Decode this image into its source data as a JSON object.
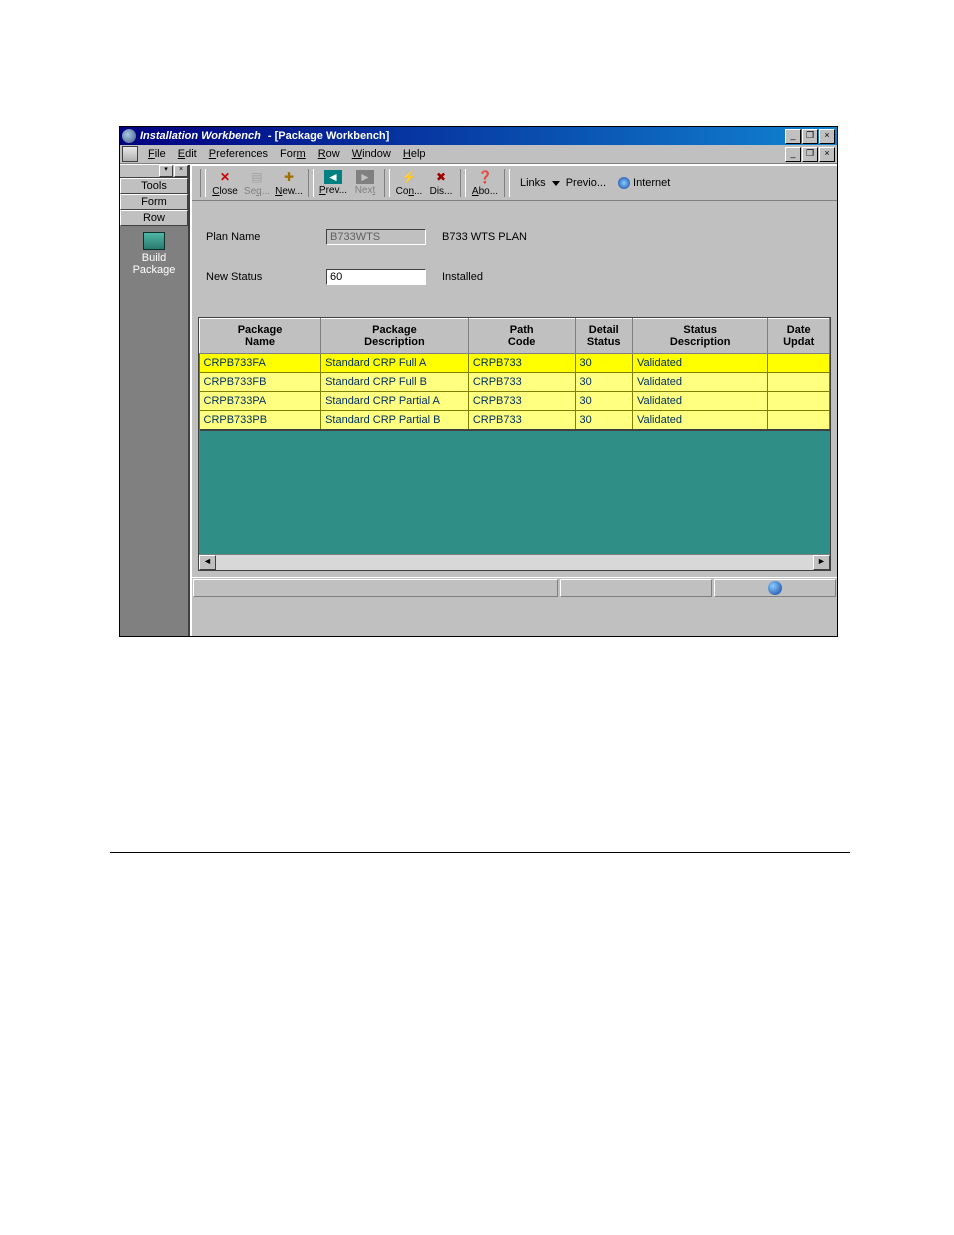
{
  "window": {
    "app_title": "Installation Workbench",
    "doc_title": "[Package Workbench]"
  },
  "menu": {
    "file": "File",
    "edit": "Edit",
    "preferences": "Preferences",
    "form": "Form",
    "row": "Row",
    "window": "Window",
    "help": "Help"
  },
  "sidebar": {
    "tabs": [
      "Tools",
      "Form",
      "Row"
    ],
    "action": {
      "line1": "Build",
      "line2": "Package"
    }
  },
  "toolbar": {
    "close": "Close",
    "seq": "Seq...",
    "new": "New...",
    "prev": "Prev...",
    "next": "Next",
    "con": "Con...",
    "dis": "Dis...",
    "abo": "Abo...",
    "links_label": "Links",
    "previo": "Previo...",
    "internet": "Internet"
  },
  "form": {
    "plan_label": "Plan Name",
    "plan_value": "B733WTS",
    "plan_desc": "B733 WTS PLAN",
    "status_label": "New Status",
    "status_value": "60",
    "status_desc": "Installed"
  },
  "grid": {
    "headers": {
      "package_name": "Package\nName",
      "package_desc": "Package\nDescription",
      "path_code": "Path\nCode",
      "detail_status": "Detail\nStatus",
      "status_desc": "Status\nDescription",
      "date_updated": "Date\nUpdat"
    },
    "rows": [
      {
        "name": "CRPB733FA",
        "desc": "Standard CRP Full  A",
        "path": "CRPB733",
        "detail": "30",
        "status": "Validated",
        "date": ""
      },
      {
        "name": "CRPB733FB",
        "desc": "Standard CRP Full  B",
        "path": "CRPB733",
        "detail": "30",
        "status": "Validated",
        "date": ""
      },
      {
        "name": "CRPB733PA",
        "desc": "Standard CRP Partial  A",
        "path": "CRPB733",
        "detail": "30",
        "status": "Validated",
        "date": ""
      },
      {
        "name": "CRPB733PB",
        "desc": "Standard CRP Partial  B",
        "path": "CRPB733",
        "detail": "30",
        "status": "Validated",
        "date": ""
      }
    ]
  }
}
